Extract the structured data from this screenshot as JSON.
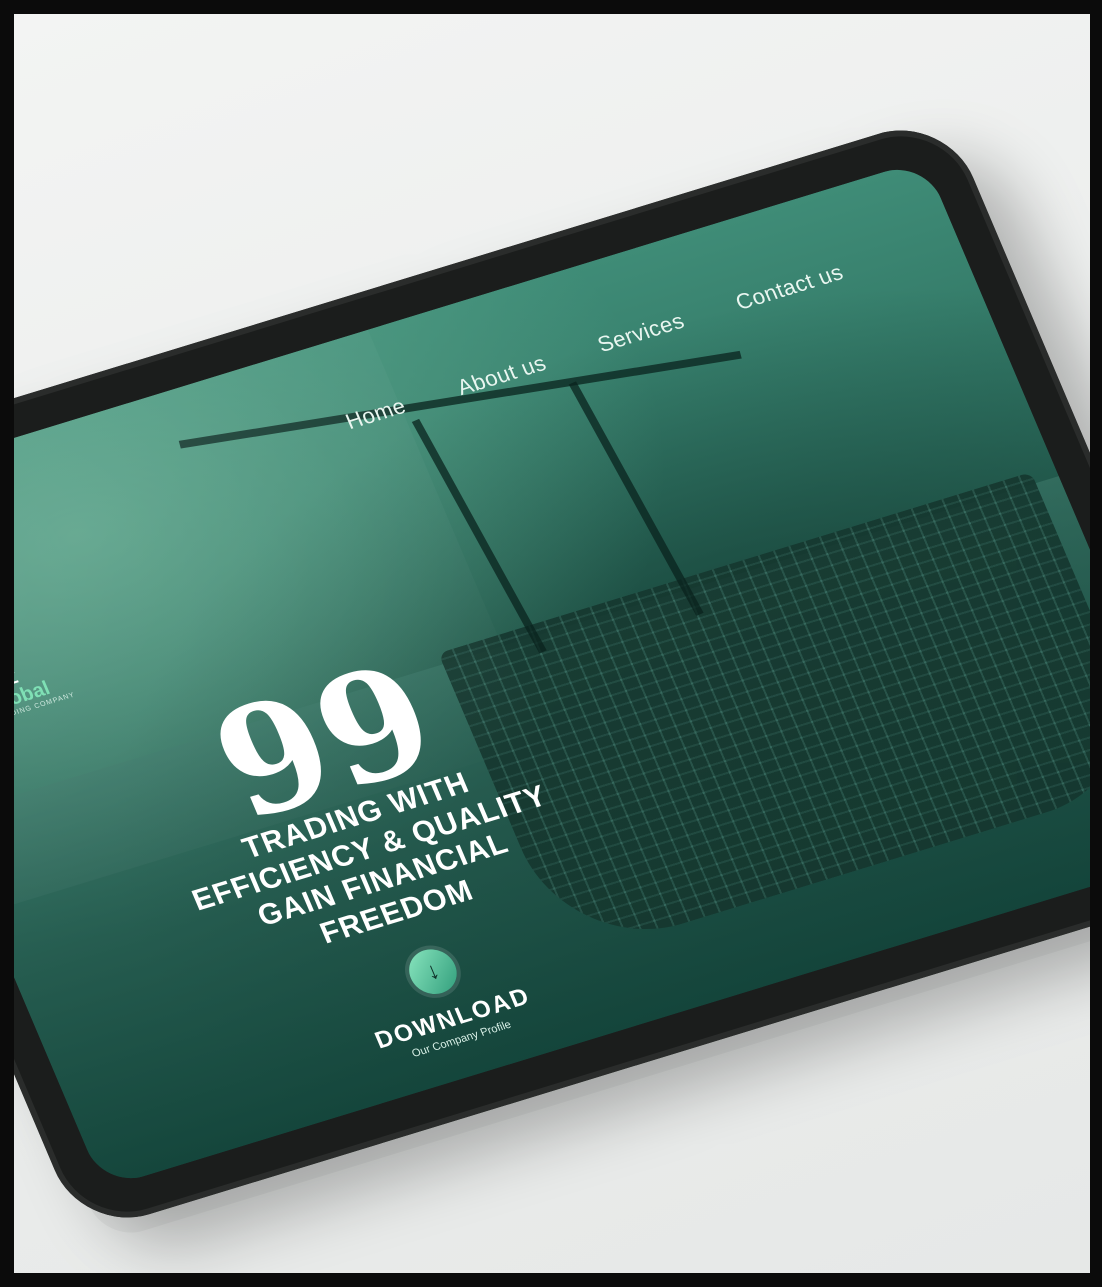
{
  "nav": {
    "items": [
      {
        "label": "Home"
      },
      {
        "label": "About us"
      },
      {
        "label": "Services"
      },
      {
        "label": "Contact us"
      }
    ]
  },
  "logo": {
    "line1": "BAZ",
    "line2": "Global",
    "tagline": "TRADING COMPANY"
  },
  "hero": {
    "quote_glyph": "99",
    "headline_lines": [
      "Trading with",
      "Efficiency & Quality",
      "Gain Financial",
      "Freedom"
    ]
  },
  "download": {
    "icon": "download-arrow-icon",
    "label": "DOWNLOAD",
    "sublabel": "Our Company Profile"
  },
  "colors": {
    "accent": "#7fe0b5",
    "screen_tint": "#2f7362",
    "device_bezel": "#1b1d1c",
    "background": "#eceeed"
  }
}
